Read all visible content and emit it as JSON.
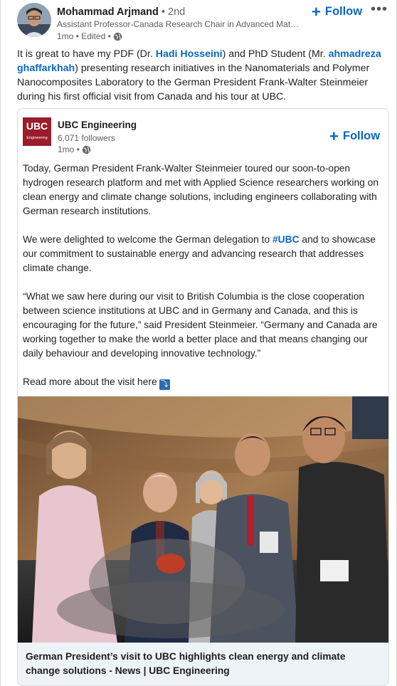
{
  "author": {
    "name": "Mohammad Arjmand",
    "degree": "• 2nd",
    "headline": "Assistant Professor-Canada Research Chair in Advanced Materi...",
    "meta": "1mo • Edited •",
    "follow_label": "Follow",
    "more_label": "•••"
  },
  "post": {
    "text_1": "It is great to have my PDF (Dr. ",
    "mention_1": "Hadi Hosseini",
    "text_2": ") and PhD Student (Mr. ",
    "mention_2": "ahmadreza ghaffarkhah",
    "text_3": ") presenting research initiatives in the Nanomaterials and Polymer Nanocomposites Laboratory to the German President Frank-Walter Steinmeier during his first official visit from Canada and his tour at UBC."
  },
  "shared": {
    "org_name": "UBC Engineering",
    "logo_big": "UBC",
    "logo_small": "Engineering",
    "followers": "6,071 followers",
    "meta": "1mo •",
    "follow_label": "Follow",
    "para_1": "Today, German President Frank-Walter Steinmeier toured our soon-to-open hydrogen research platform and met with Applied Science researchers working on clean energy and climate change solutions, including engineers collaborating with German research institutions.",
    "para_2_a": "We were delighted to welcome the German delegation to ",
    "hashtag": "#UBC",
    "para_2_b": " and to showcase our commitment to sustainable energy and advancing research that addresses climate change.",
    "para_3": "“What we saw here during our visit to British Columbia is the close cooperation between science institutions at UBC and in Germany and Canada, and this is encouraging for the future,” said President Steinmeier. “Germany and Canada are working together to make the world a better place and that means changing our daily behaviour and developing innovative technology.”",
    "read_more": "Read more about the visit here",
    "read_more_icon": "⤵",
    "caption": "German President’s visit to UBC highlights clean energy and climate change solutions - News | UBC Engineering"
  },
  "colors": {
    "link": "#0a66c2",
    "ubc_red": "#9b1c2a",
    "caption_bg": "#eef3f8"
  }
}
